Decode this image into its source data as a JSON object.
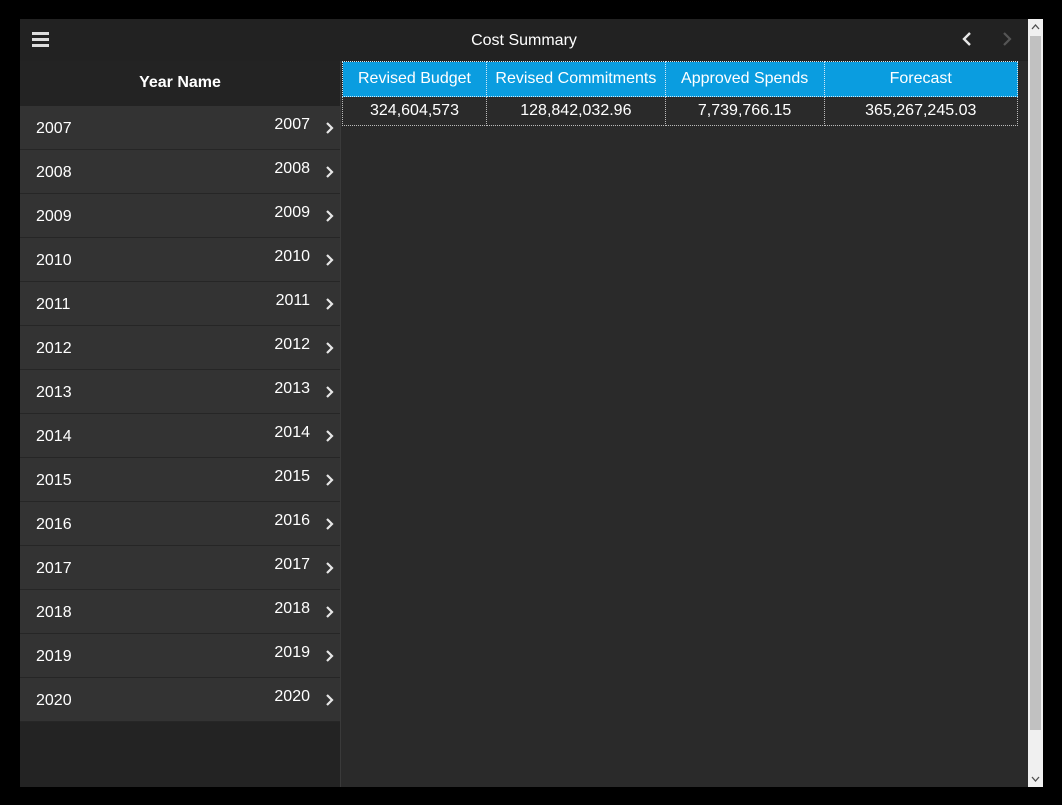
{
  "header": {
    "title": "Cost Summary"
  },
  "sidebar": {
    "header": "Year Name",
    "items": [
      {
        "label": "2007",
        "value": "2007"
      },
      {
        "label": "2008",
        "value": "2008"
      },
      {
        "label": "2009",
        "value": "2009"
      },
      {
        "label": "2010",
        "value": "2010"
      },
      {
        "label": "2011",
        "value": "2011"
      },
      {
        "label": "2012",
        "value": "2012"
      },
      {
        "label": "2013",
        "value": "2013"
      },
      {
        "label": "2014",
        "value": "2014"
      },
      {
        "label": "2015",
        "value": "2015"
      },
      {
        "label": "2016",
        "value": "2016"
      },
      {
        "label": "2017",
        "value": "2017"
      },
      {
        "label": "2018",
        "value": "2018"
      },
      {
        "label": "2019",
        "value": "2019"
      },
      {
        "label": "2020",
        "value": "2020"
      }
    ]
  },
  "table": {
    "columns": [
      "Revised Budget",
      "Revised Commitments",
      "Approved Spends",
      "Forecast"
    ],
    "rows": [
      [
        "324,604,573",
        "128,842,032.96",
        "7,739,766.15",
        "365,267,245.03"
      ]
    ]
  },
  "colors": {
    "header_accent": "#0a9de0",
    "background": "#2a2a2a",
    "sidebar_item": "#333333"
  },
  "icons": [
    "menu-icon",
    "chevron-left-icon",
    "chevron-right-icon",
    "scroll-up-icon",
    "scroll-down-icon"
  ]
}
